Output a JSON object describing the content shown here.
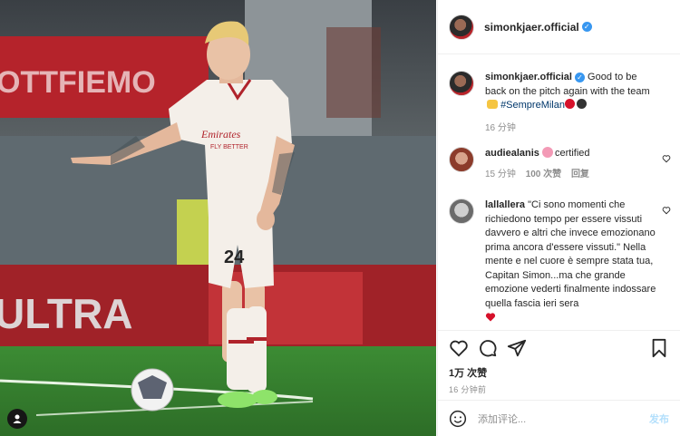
{
  "post": {
    "author": "simonkjaer.official",
    "verified_icon": "verified-badge-icon",
    "caption": {
      "username": "simonkjaer.official",
      "text": "Good to be back on the pitch again with the team",
      "hashtag": "#SempreMilan",
      "time": "16 分钟"
    },
    "comments": [
      {
        "username": "audiealanis",
        "text": "certified",
        "time": "15 分钟",
        "likes": "100 次赞",
        "reply": "回复"
      },
      {
        "username": "lallallera",
        "text": "\"Ci sono momenti che richiedono tempo per essere vissuti davvero e altri che invece emozionano prima ancora d'essere vissuti.\"  Nella mente e nel cuore è sempre stata tua, Capitan Simon...ma che grande emozione vederti finalmente indossare quella fascia ieri sera"
      }
    ],
    "likes": "1万 次赞",
    "timestamp": "16 分钟前",
    "add_comment_placeholder": "添加评论...",
    "post_button": "发布"
  },
  "photo": {
    "shirt_sponsor": "Emirates",
    "shirt_sub": "FLY BETTER",
    "shirt_number": "24",
    "board_text": "ULTRA",
    "banner_text": "OTTFIEMO"
  },
  "colors": {
    "link": "#00376b",
    "verified": "#3897f0",
    "muted": "#8e8e8e",
    "post_disabled": "#b2dffc",
    "milan_red": "#d6112a"
  }
}
